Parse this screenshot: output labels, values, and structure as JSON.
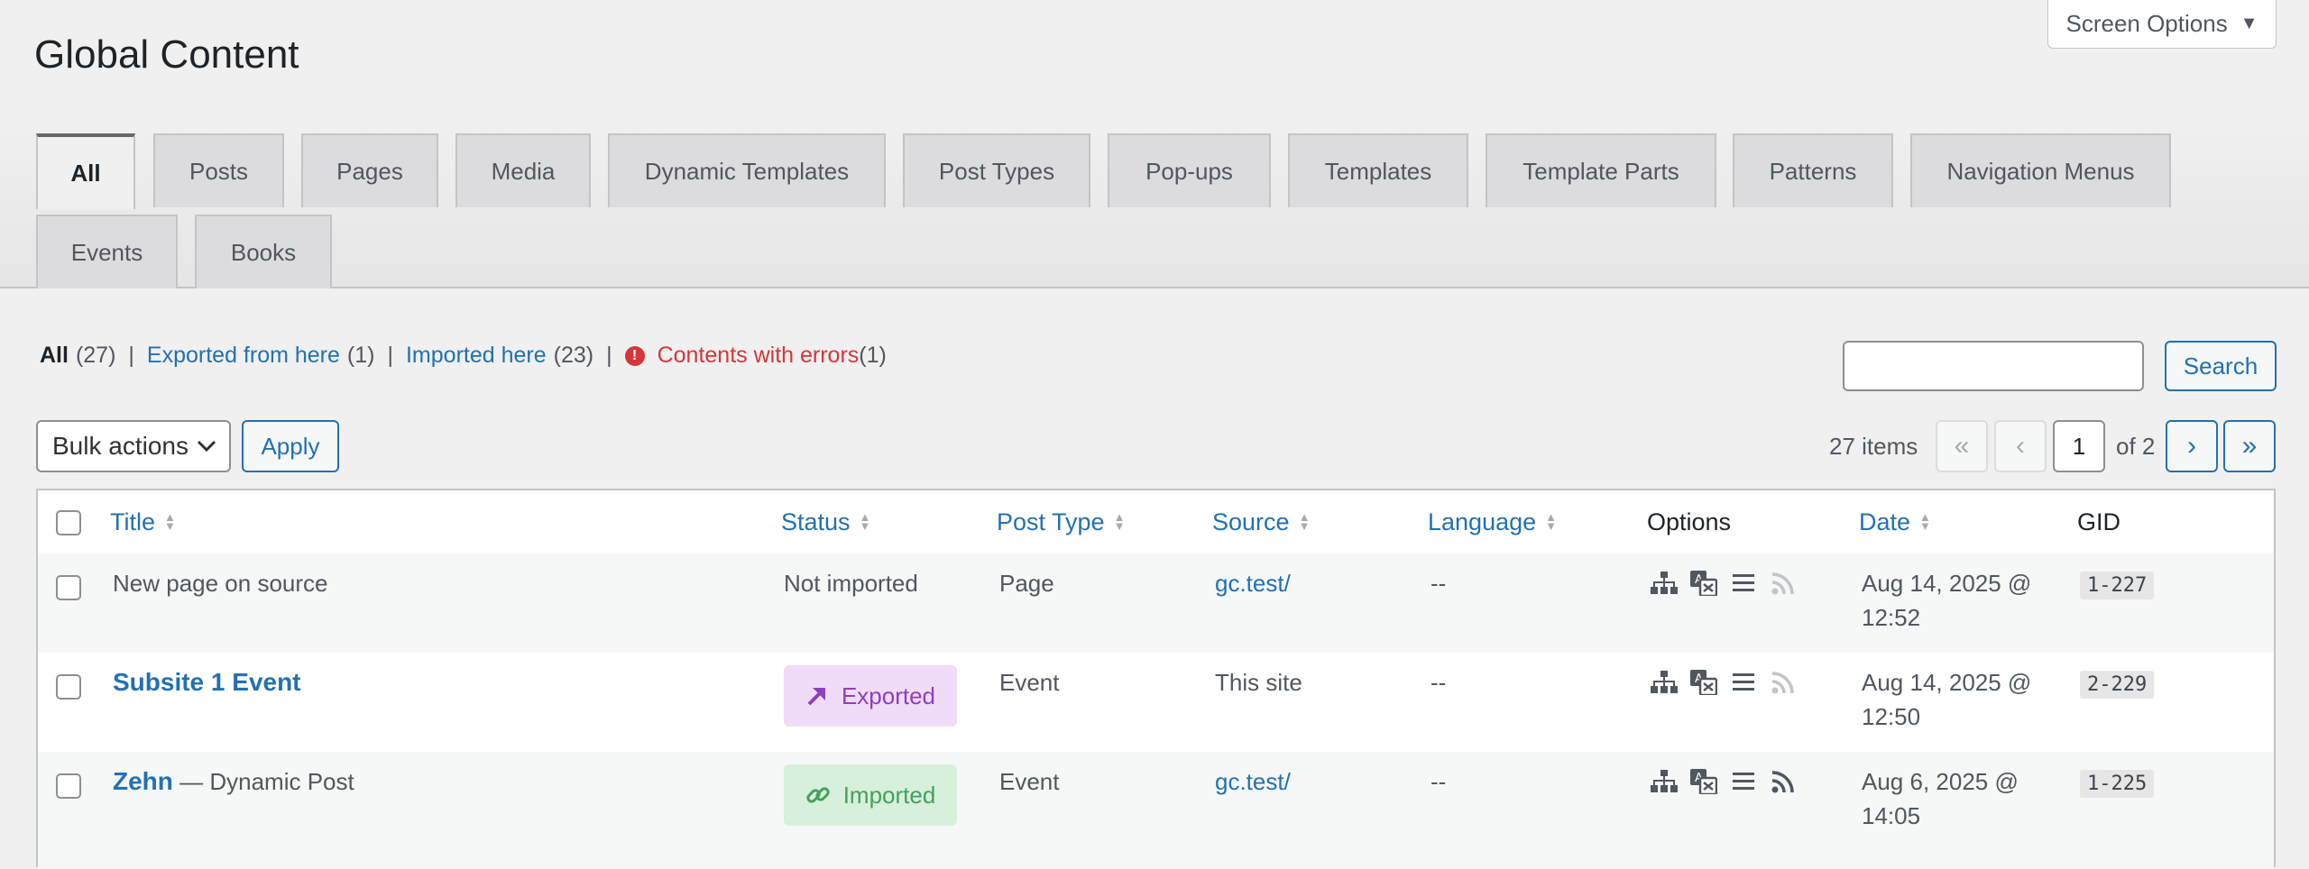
{
  "screen_options": {
    "label": "Screen Options",
    "caret": "▼"
  },
  "page_title": "Global Content",
  "tabs": [
    {
      "label": "All",
      "active": true
    },
    {
      "label": "Posts"
    },
    {
      "label": "Pages"
    },
    {
      "label": "Media"
    },
    {
      "label": "Dynamic Templates"
    },
    {
      "label": "Post Types"
    },
    {
      "label": "Pop-ups"
    },
    {
      "label": "Templates"
    },
    {
      "label": "Template Parts"
    },
    {
      "label": "Patterns"
    },
    {
      "label": "Navigation Menus"
    },
    {
      "label": "Events"
    },
    {
      "label": "Books"
    }
  ],
  "filters": {
    "all_label": "All",
    "all_count": "(27)",
    "exported_label": "Exported from here",
    "exported_count": "(1)",
    "imported_label": "Imported here",
    "imported_count": "(23)",
    "errors_label": "Contents with errors",
    "errors_count": "(1)",
    "separator": "|",
    "error_icon": "!"
  },
  "search": {
    "button_label": "Search",
    "value": ""
  },
  "bulk": {
    "label": "Bulk actions",
    "apply_label": "Apply"
  },
  "pagination": {
    "items": "27 items",
    "first": "«",
    "prev": "‹",
    "current": "1",
    "of": "of 2",
    "next": "›",
    "last": "»"
  },
  "columns": {
    "title": "Title",
    "status": "Status",
    "post_type": "Post Type",
    "source": "Source",
    "language": "Language",
    "options": "Options",
    "date": "Date",
    "gid": "GID"
  },
  "rows": [
    {
      "title": "New page on source",
      "title_suffix": "",
      "status": "Not imported",
      "post_type": "Page",
      "source": "gc.test/",
      "language": "--",
      "date_line1": "Aug 14, 2025 @",
      "date_line2": "12:52",
      "gid": "1-227"
    },
    {
      "title": "Subsite 1 Event",
      "title_suffix": "",
      "status": "Exported",
      "post_type": "Event",
      "source": "This site",
      "language": "--",
      "date_line1": "Aug 14, 2025 @",
      "date_line2": "12:50",
      "gid": "2-229"
    },
    {
      "title": "Zehn",
      "title_suffix": " — Dynamic Post",
      "status": "Imported",
      "post_type": "Event",
      "source": "gc.test/",
      "language": "--",
      "date_line1": "Aug 6, 2025 @",
      "date_line2": "14:05",
      "gid": "1-225"
    }
  ],
  "icons": {
    "options": [
      "sitemap-icon",
      "translate-icon",
      "list-icon",
      "rss-icon"
    ],
    "exported": "arrow-up-right-icon",
    "imported": "link-icon"
  },
  "colors": {
    "link": "#2271b1",
    "error": "#d63638",
    "exported_bg": "#f0dcf9",
    "exported_fg": "#8e3fbb",
    "imported_bg": "#d6f0dc",
    "imported_fg": "#46a05c"
  }
}
